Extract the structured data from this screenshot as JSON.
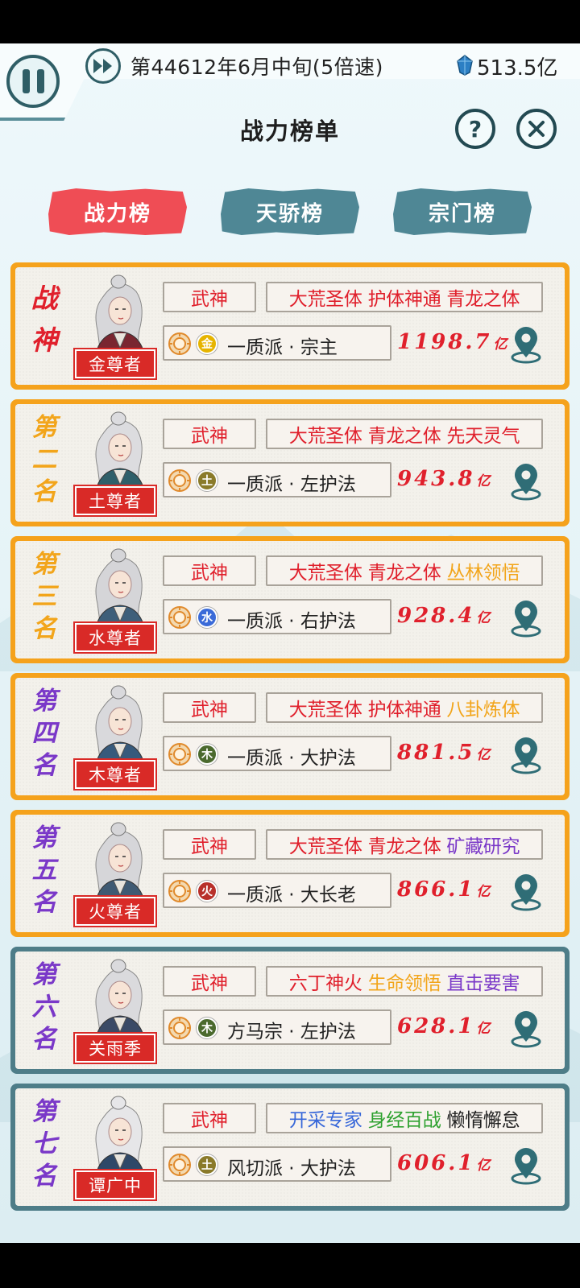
{
  "topbar": {
    "date": "第44612年6月中旬(5倍速)",
    "money": "513.5亿"
  },
  "title": "战力榜单",
  "help_label": "?",
  "tabs": [
    {
      "label": "战力榜",
      "active": true
    },
    {
      "label": "天骄榜",
      "active": false
    },
    {
      "label": "宗门榜",
      "active": false
    }
  ],
  "colors": {
    "gold_frame": "#f5a21c",
    "blue_frame": "#4e7d88",
    "accent_red": "#e0202c",
    "tab_active": "#ef4d55",
    "tab_inactive": "#4f8795"
  },
  "entries": [
    {
      "rank": [
        "战",
        "神"
      ],
      "name": "金尊者",
      "title": "武神",
      "traits": [
        {
          "text": "大荒圣体",
          "color": "red"
        },
        {
          "text": "护体神通",
          "color": "red"
        },
        {
          "text": "青龙之体",
          "color": "red"
        }
      ],
      "element": "金",
      "element_color": "#e6b400",
      "sect": "一质派 · 宗主",
      "power": "1198.7",
      "unit": "亿",
      "icon": "location-pin-icon"
    },
    {
      "rank": [
        "第",
        "二",
        "名"
      ],
      "name": "土尊者",
      "title": "武神",
      "traits": [
        {
          "text": "大荒圣体",
          "color": "red"
        },
        {
          "text": "青龙之体",
          "color": "red"
        },
        {
          "text": "先天灵气",
          "color": "red"
        }
      ],
      "element": "土",
      "element_color": "#8a7a2a",
      "sect": "一质派 · 左护法",
      "power": "943.8",
      "unit": "亿",
      "icon": "location-pin-icon"
    },
    {
      "rank": [
        "第",
        "三",
        "名"
      ],
      "name": "水尊者",
      "title": "武神",
      "traits": [
        {
          "text": "大荒圣体",
          "color": "red"
        },
        {
          "text": "青龙之体",
          "color": "red"
        },
        {
          "text": "丛林领悟",
          "color": "orange"
        }
      ],
      "element": "水",
      "element_color": "#3a6ad8",
      "sect": "一质派 · 右护法",
      "power": "928.4",
      "unit": "亿",
      "icon": "location-pin-icon"
    },
    {
      "rank": [
        "第",
        "四",
        "名"
      ],
      "name": "木尊者",
      "title": "武神",
      "traits": [
        {
          "text": "大荒圣体",
          "color": "red"
        },
        {
          "text": "护体神通",
          "color": "red"
        },
        {
          "text": "八卦炼体",
          "color": "orange"
        }
      ],
      "element": "木",
      "element_color": "#4b6a2e",
      "sect": "一质派 · 大护法",
      "power": "881.5",
      "unit": "亿",
      "icon": "location-pin-icon"
    },
    {
      "rank": [
        "第",
        "五",
        "名"
      ],
      "name": "火尊者",
      "title": "武神",
      "traits": [
        {
          "text": "大荒圣体",
          "color": "red"
        },
        {
          "text": "青龙之体",
          "color": "red"
        },
        {
          "text": "矿藏研究",
          "color": "purple"
        }
      ],
      "element": "火",
      "element_color": "#b8302a",
      "sect": "一质派 · 大长老",
      "power": "866.1",
      "unit": "亿",
      "icon": "location-pin-icon"
    },
    {
      "rank": [
        "第",
        "六",
        "名"
      ],
      "name": "关雨季",
      "title": "武神",
      "traits": [
        {
          "text": "六丁神火",
          "color": "red"
        },
        {
          "text": "生命领悟",
          "color": "orange"
        },
        {
          "text": "直击要害",
          "color": "purple"
        }
      ],
      "element": "木",
      "element_color": "#4b6a2e",
      "sect": "方马宗 · 左护法",
      "power": "628.1",
      "unit": "亿",
      "icon": "location-pin-icon"
    },
    {
      "rank": [
        "第",
        "七",
        "名"
      ],
      "name": "谭广中",
      "title": "武神",
      "traits": [
        {
          "text": "开采专家",
          "color": "blue"
        },
        {
          "text": "身经百战",
          "color": "green"
        },
        {
          "text": "懒惰懈怠",
          "color": "dark"
        }
      ],
      "element": "土",
      "element_color": "#8a7a2a",
      "sect": "风切派 · 大护法",
      "power": "606.1",
      "unit": "亿",
      "icon": "location-pin-icon"
    }
  ]
}
